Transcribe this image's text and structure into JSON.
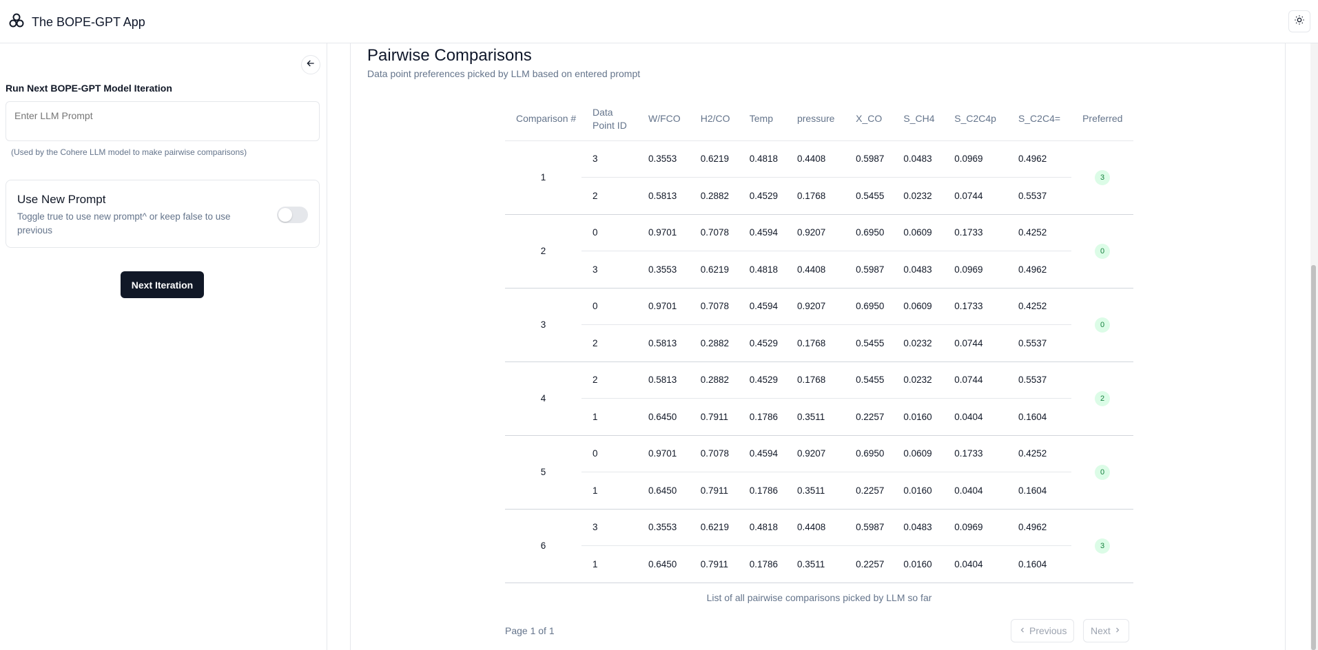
{
  "header": {
    "title": "The BOPE-GPT App"
  },
  "sidebar": {
    "run_title": "Run Next BOPE-GPT Model Iteration",
    "prompt_placeholder": "Enter LLM Prompt",
    "prompt_hint": "(Used by the Cohere LLM model to make pairwise comparisons)",
    "toggle_title": "Use New Prompt",
    "toggle_desc": "Toggle true to use new prompt^ or keep false to use previous",
    "next_button": "Next Iteration"
  },
  "main": {
    "title": "Pairwise Comparisons",
    "subtitle": "Data point preferences picked by LLM based on entered prompt",
    "columns": [
      "Comparison #",
      "Data Point ID",
      "W/FCO",
      "H2/CO",
      "Temp",
      "pressure",
      "X_CO",
      "S_CH4",
      "S_C2C4p",
      "S_C2C4=",
      "Preferred"
    ],
    "comparisons": [
      {
        "num": "1",
        "preferred": "3",
        "rows": [
          [
            "3",
            "0.3553",
            "0.6219",
            "0.4818",
            "0.4408",
            "0.5987",
            "0.0483",
            "0.0969",
            "0.4962"
          ],
          [
            "2",
            "0.5813",
            "0.2882",
            "0.4529",
            "0.1768",
            "0.5455",
            "0.0232",
            "0.0744",
            "0.5537"
          ]
        ]
      },
      {
        "num": "2",
        "preferred": "0",
        "rows": [
          [
            "0",
            "0.9701",
            "0.7078",
            "0.4594",
            "0.9207",
            "0.6950",
            "0.0609",
            "0.1733",
            "0.4252"
          ],
          [
            "3",
            "0.3553",
            "0.6219",
            "0.4818",
            "0.4408",
            "0.5987",
            "0.0483",
            "0.0969",
            "0.4962"
          ]
        ]
      },
      {
        "num": "3",
        "preferred": "0",
        "rows": [
          [
            "0",
            "0.9701",
            "0.7078",
            "0.4594",
            "0.9207",
            "0.6950",
            "0.0609",
            "0.1733",
            "0.4252"
          ],
          [
            "2",
            "0.5813",
            "0.2882",
            "0.4529",
            "0.1768",
            "0.5455",
            "0.0232",
            "0.0744",
            "0.5537"
          ]
        ]
      },
      {
        "num": "4",
        "preferred": "2",
        "rows": [
          [
            "2",
            "0.5813",
            "0.2882",
            "0.4529",
            "0.1768",
            "0.5455",
            "0.0232",
            "0.0744",
            "0.5537"
          ],
          [
            "1",
            "0.6450",
            "0.7911",
            "0.1786",
            "0.3511",
            "0.2257",
            "0.0160",
            "0.0404",
            "0.1604"
          ]
        ]
      },
      {
        "num": "5",
        "preferred": "0",
        "rows": [
          [
            "0",
            "0.9701",
            "0.7078",
            "0.4594",
            "0.9207",
            "0.6950",
            "0.0609",
            "0.1733",
            "0.4252"
          ],
          [
            "1",
            "0.6450",
            "0.7911",
            "0.1786",
            "0.3511",
            "0.2257",
            "0.0160",
            "0.0404",
            "0.1604"
          ]
        ]
      },
      {
        "num": "6",
        "preferred": "3",
        "rows": [
          [
            "3",
            "0.3553",
            "0.6219",
            "0.4818",
            "0.4408",
            "0.5987",
            "0.0483",
            "0.0969",
            "0.4962"
          ],
          [
            "1",
            "0.6450",
            "0.7911",
            "0.1786",
            "0.3511",
            "0.2257",
            "0.0160",
            "0.0404",
            "0.1604"
          ]
        ]
      }
    ],
    "caption": "List of all pairwise comparisons picked by LLM so far",
    "page_info": "Page 1 of 1",
    "prev_label": "Previous",
    "next_label": "Next"
  },
  "colors": {
    "primary_button": "#111827",
    "badge_bg": "#dcfce7",
    "badge_text": "#15803d",
    "muted_text": "#64748b"
  }
}
